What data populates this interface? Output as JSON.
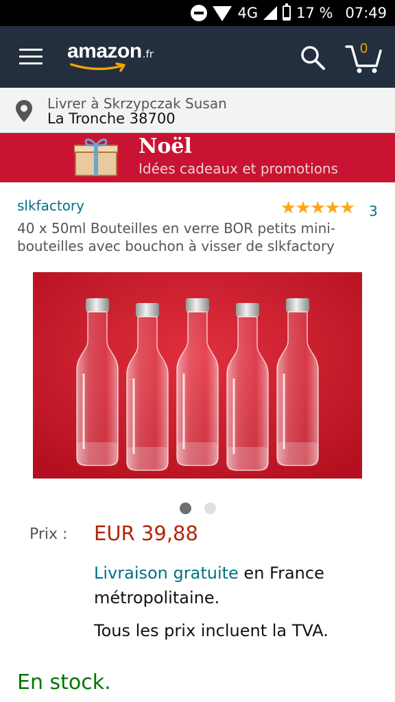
{
  "status_bar": {
    "network": "4G",
    "battery": "17 %",
    "time": "07:49"
  },
  "header": {
    "logo_text": "amazon",
    "logo_suffix": ".fr",
    "cart_count": "0"
  },
  "location": {
    "label": "Livrer à Skrzypczak Susan",
    "value": "La Tronche 38700"
  },
  "banner": {
    "title": "Noël",
    "subtitle": "Idées cadeaux et promotions"
  },
  "product": {
    "brand": "slkfactory",
    "rating": 5,
    "rating_count": "3",
    "title": "40 x 50ml Bouteilles en verre BOR petits mini-bouteilles avec bouchon à visser de slkfactory",
    "image_count": 2,
    "active_image": 0
  },
  "pricing": {
    "label": "Prix :",
    "value": "EUR 39,88",
    "shipping_link": "Livraison gratuite",
    "shipping_rest": " en France métropolitaine.",
    "vat_note": "Tous les prix incluent la TVA.",
    "stock": "En stock."
  },
  "colors": {
    "header_bg": "#232f3e",
    "banner_bg": "#c81332",
    "link": "#007185",
    "price": "#b12704",
    "stock": "#007600",
    "star": "#ffa41c"
  },
  "icons": [
    "do-not-disturb-icon",
    "wifi-icon",
    "signal-icon",
    "battery-icon",
    "menu-icon",
    "search-icon",
    "cart-icon",
    "location-pin-icon",
    "gift-icon",
    "star-icon"
  ]
}
